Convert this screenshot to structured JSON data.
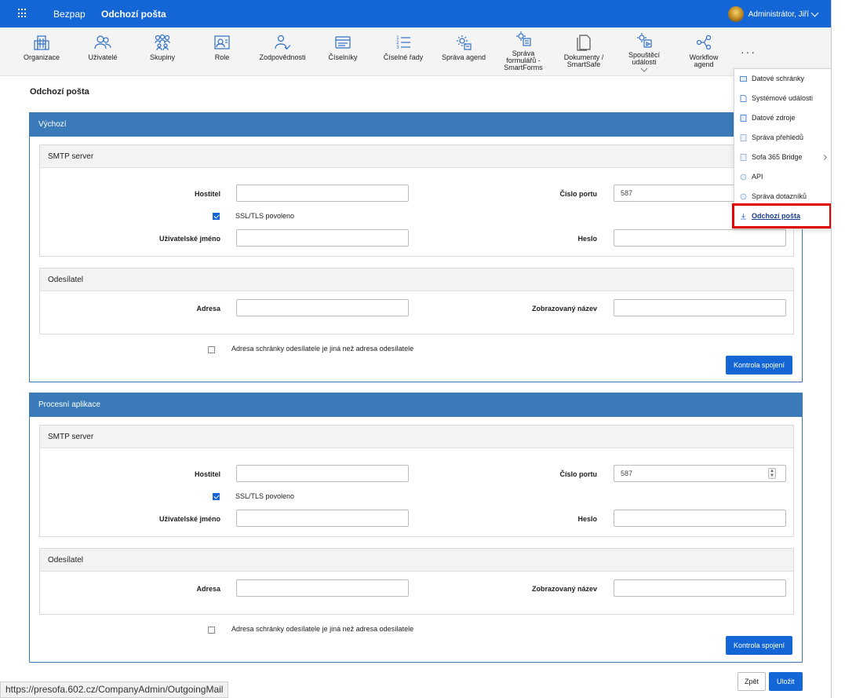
{
  "topbar": {
    "brand": "Bezpap",
    "title": "Odchozí pošta",
    "user": "Administrátor, Jiří"
  },
  "toolbar": {
    "items": [
      {
        "label": "Organizace",
        "icon": "organization-icon"
      },
      {
        "label": "Uživatelé",
        "icon": "users-icon"
      },
      {
        "label": "Skupiny",
        "icon": "groups-icon"
      },
      {
        "label": "Role",
        "icon": "role-icon"
      },
      {
        "label": "Zodpovědnosti",
        "icon": "responsibility-icon"
      },
      {
        "label": "Číselníky",
        "icon": "codelist-icon"
      },
      {
        "label": "Číselné řady",
        "icon": "number-series-icon"
      },
      {
        "label": "Správa agend",
        "icon": "agenda-gear-icon"
      },
      {
        "label": "Správa formulářů - SmartForms",
        "icon": "forms-gear-icon"
      },
      {
        "label": "Dokumenty / SmartSafe",
        "icon": "documents-icon"
      },
      {
        "label": "Spouštěcí události",
        "icon": "trigger-events-icon"
      },
      {
        "label": "Workflow agend",
        "icon": "workflow-icon"
      }
    ],
    "more": "···"
  },
  "page": {
    "title": "Odchozí pošta"
  },
  "sections": [
    {
      "title": "Výchozí",
      "smtp_title": "SMTP server",
      "host_label": "Hostitel",
      "host_value": "",
      "port_label": "Číslo portu",
      "port_value": "587",
      "ssl_label": "SSL/TLS povoleno",
      "ssl_checked": true,
      "user_label": "Uživatelské jméno",
      "user_value": "",
      "pass_label": "Heslo",
      "pass_value": "",
      "sender_title": "Odesílatel",
      "address_label": "Adresa",
      "address_value": "",
      "display_label": "Zobrazovaný název",
      "display_value": "",
      "diff_label": "Adresa schránky odesílatele je jiná než adresa odesílatele",
      "diff_checked": false,
      "test_button": "Kontrola spojení"
    },
    {
      "title": "Procesní aplikace",
      "smtp_title": "SMTP server",
      "host_label": "Hostitel",
      "host_value": "",
      "port_label": "Číslo portu",
      "port_value": "587",
      "ssl_label": "SSL/TLS povoleno",
      "ssl_checked": true,
      "user_label": "Uživatelské jméno",
      "user_value": "",
      "pass_label": "Heslo",
      "pass_value": "",
      "sender_title": "Odesílatel",
      "address_label": "Adresa",
      "address_value": "",
      "display_label": "Zobrazovaný název",
      "display_value": "",
      "diff_label": "Adresa schránky odesílatele je jiná než adresa odesílatele",
      "diff_checked": false,
      "test_button": "Kontrola spojení"
    }
  ],
  "footer": {
    "back": "Zpět",
    "save": "Uložit"
  },
  "menu": {
    "items": [
      {
        "label": "Datové schránky",
        "icon": "data-box-icon"
      },
      {
        "label": "Systémové události",
        "icon": "system-events-icon"
      },
      {
        "label": "Datové zdroje",
        "icon": "data-sources-icon"
      },
      {
        "label": "Správa přehledů",
        "icon": "overviews-icon"
      },
      {
        "label": "Sofa 365 Bridge",
        "icon": "bridge-icon",
        "has_submenu": true
      },
      {
        "label": "API",
        "icon": "api-icon"
      },
      {
        "label": "Správa dotazníků",
        "icon": "questionnaires-icon"
      },
      {
        "label": "Odchozí pošta",
        "icon": "outgoing-mail-icon",
        "active": true
      }
    ]
  },
  "status_url": "https://presofa.602.cz/CompanyAdmin/OutgoingMail",
  "colors": {
    "primary": "#1466d6",
    "panel_header": "#3a7ab8",
    "highlight": "#e00000"
  }
}
